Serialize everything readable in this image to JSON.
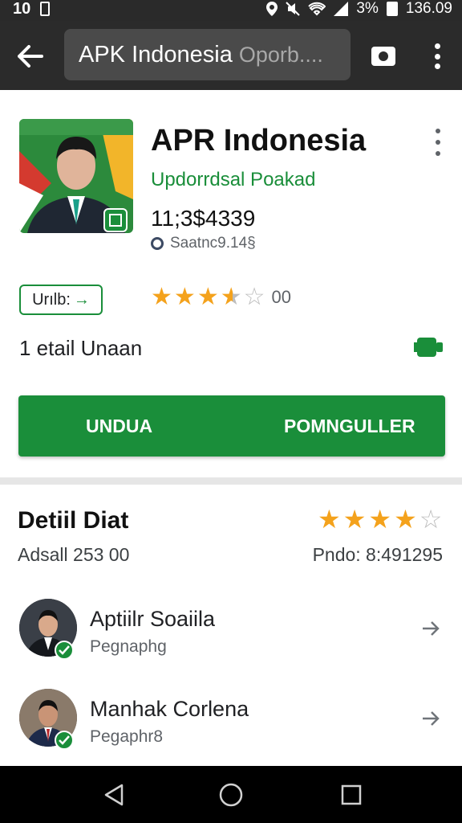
{
  "status_bar": {
    "left_time": "10",
    "battery": "3%",
    "clock": "136.09"
  },
  "toolbar": {
    "title": "APK Indonesia",
    "subtitle": "Oporb....",
    "back_icon": "arrow-left-icon",
    "camera_icon": "camera-icon",
    "menu_icon": "more-vert-icon"
  },
  "app": {
    "title": "APR Indonesia",
    "developer": "Updorrdsal Poakad",
    "size": "11;3$4339",
    "sub_info": "Saatnc9.14§",
    "update_label": "Urılb:",
    "rating_value": 3.5,
    "rating_count": "00",
    "detail_label": "1 etail Unaan"
  },
  "actions": {
    "install": "UNDUA",
    "open": "POMNGULLER"
  },
  "details": {
    "title": "Detiil Diat",
    "rating_value": 4,
    "left_info": "Adsall 253 00",
    "right_info": "Pndo: 8:491295",
    "reviews": [
      {
        "name": "Aptiilr Soaiila",
        "meta": "Pegnaphg"
      },
      {
        "name": "Manhak Corlena",
        "meta": "Pegaphr8"
      }
    ]
  },
  "colors": {
    "accent": "#1a8e3a",
    "toolbar": "#2b2b2b",
    "star": "#f4a21c"
  }
}
